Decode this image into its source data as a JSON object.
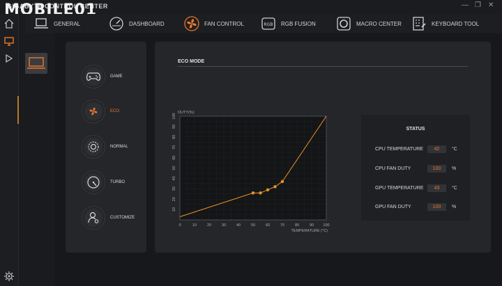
{
  "app": {
    "title": "GIGABYTE CONTROL CENTER",
    "watermark": "MOBILE01"
  },
  "nav": [
    {
      "label": "GENERAL",
      "icon": "laptop-icon"
    },
    {
      "label": "DASHBOARD",
      "icon": "gauge-icon"
    },
    {
      "label": "FAN CONTROL",
      "icon": "fan-icon",
      "active": true
    },
    {
      "label": "RGB FUSION",
      "icon": "rgb-icon"
    },
    {
      "label": "MACRO CENTER",
      "icon": "macro-icon"
    },
    {
      "label": "KEYBOARD TOOL",
      "icon": "keyboard-icon"
    }
  ],
  "modes": [
    {
      "label": "GAME",
      "icon": "gamepad-icon"
    },
    {
      "label": "ECO",
      "icon": "fan-icon",
      "active": true
    },
    {
      "label": "NORMAL",
      "icon": "normal-icon"
    },
    {
      "label": "TURBO",
      "icon": "speedometer-icon"
    },
    {
      "label": "CUSTOMIZE",
      "icon": "user-icon"
    }
  ],
  "main": {
    "mode_title": "ECO MODE"
  },
  "status": {
    "title": "STATUS",
    "rows": [
      {
        "label": "CPU TEMPERATURE",
        "value": "42",
        "unit": "°C"
      },
      {
        "label": "CPU FAN DUTY",
        "value": "100",
        "unit": "%"
      },
      {
        "label": "GPU TEMPERATURE",
        "value": "43",
        "unit": "°C"
      },
      {
        "label": "GPU FAN DUTY",
        "value": "100",
        "unit": "%"
      }
    ]
  },
  "colors": {
    "accent": "#e8782a",
    "curve": "#e8952a"
  },
  "chart_data": {
    "type": "line",
    "title": "",
    "xlabel": "TEMPERATURE (°C)",
    "ylabel": "DUTY(%)",
    "xlim": [
      0,
      100
    ],
    "ylim": [
      0,
      100
    ],
    "xticks": [
      0,
      10,
      20,
      30,
      40,
      50,
      60,
      70,
      80,
      90,
      100
    ],
    "yticks": [
      10,
      20,
      30,
      40,
      50,
      60,
      70,
      80,
      90,
      100
    ],
    "grid": true,
    "series": [
      {
        "x": [
          0,
          50,
          55,
          60,
          65,
          70,
          100
        ],
        "y": [
          3,
          26,
          26,
          29,
          32,
          37,
          100
        ],
        "markers": [
          50,
          55,
          60,
          65,
          70
        ]
      }
    ]
  }
}
